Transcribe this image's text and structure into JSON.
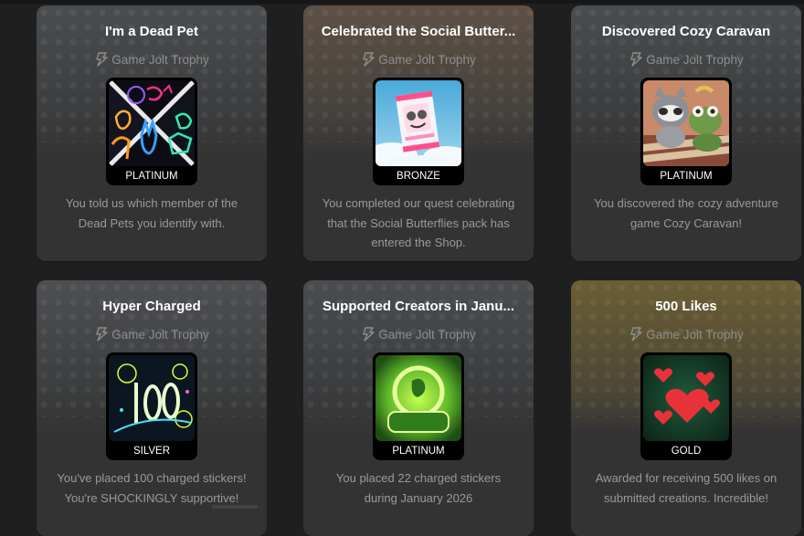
{
  "cards": [
    {
      "title": "I'm a Dead Pet",
      "subtitle": "Game Jolt Trophy",
      "tier": "PLATINUM",
      "description": "You told us which member of the Dead Pets you identify with.",
      "art_icon": "dead-pets-art"
    },
    {
      "title": "Celebrated the Social Butter...",
      "subtitle": "Game Jolt Trophy",
      "tier": "BRONZE",
      "description": "You completed our quest celebrating that the Social Butterflies pack has entered the Shop.",
      "art_icon": "sticker-pack-art"
    },
    {
      "title": "Discovered Cozy Caravan",
      "subtitle": "Game Jolt Trophy",
      "tier": "PLATINUM",
      "description": "You discovered the cozy adventure game Cozy Caravan!",
      "art_icon": "cozy-caravan-art"
    },
    {
      "title": "Hyper Charged",
      "subtitle": "Game Jolt Trophy",
      "tier": "SILVER",
      "description": "You've placed 100 charged stickers! You're SHOCKINGLY supportive!",
      "art_icon": "hyper-charged-art"
    },
    {
      "title": "Supported Creators in Janu...",
      "subtitle": "Game Jolt Trophy",
      "tier": "PLATINUM",
      "description": "You placed 22 charged stickers during January 2026",
      "art_icon": "creators-2026-art"
    },
    {
      "title": "500 Likes",
      "subtitle": "Game Jolt Trophy",
      "tier": "GOLD",
      "description": "Awarded for receiving 500 likes on submitted creations. Incredible!",
      "art_icon": "hearts-art"
    }
  ],
  "colors": {
    "background": "#1f1f1f",
    "card": "#333333",
    "title": "#ffffff",
    "muted": "#8e8e8e",
    "bronze_tint": "#5e5045",
    "gold_tint": "#6b5e34",
    "platinum_tint": "#4a4d50"
  }
}
